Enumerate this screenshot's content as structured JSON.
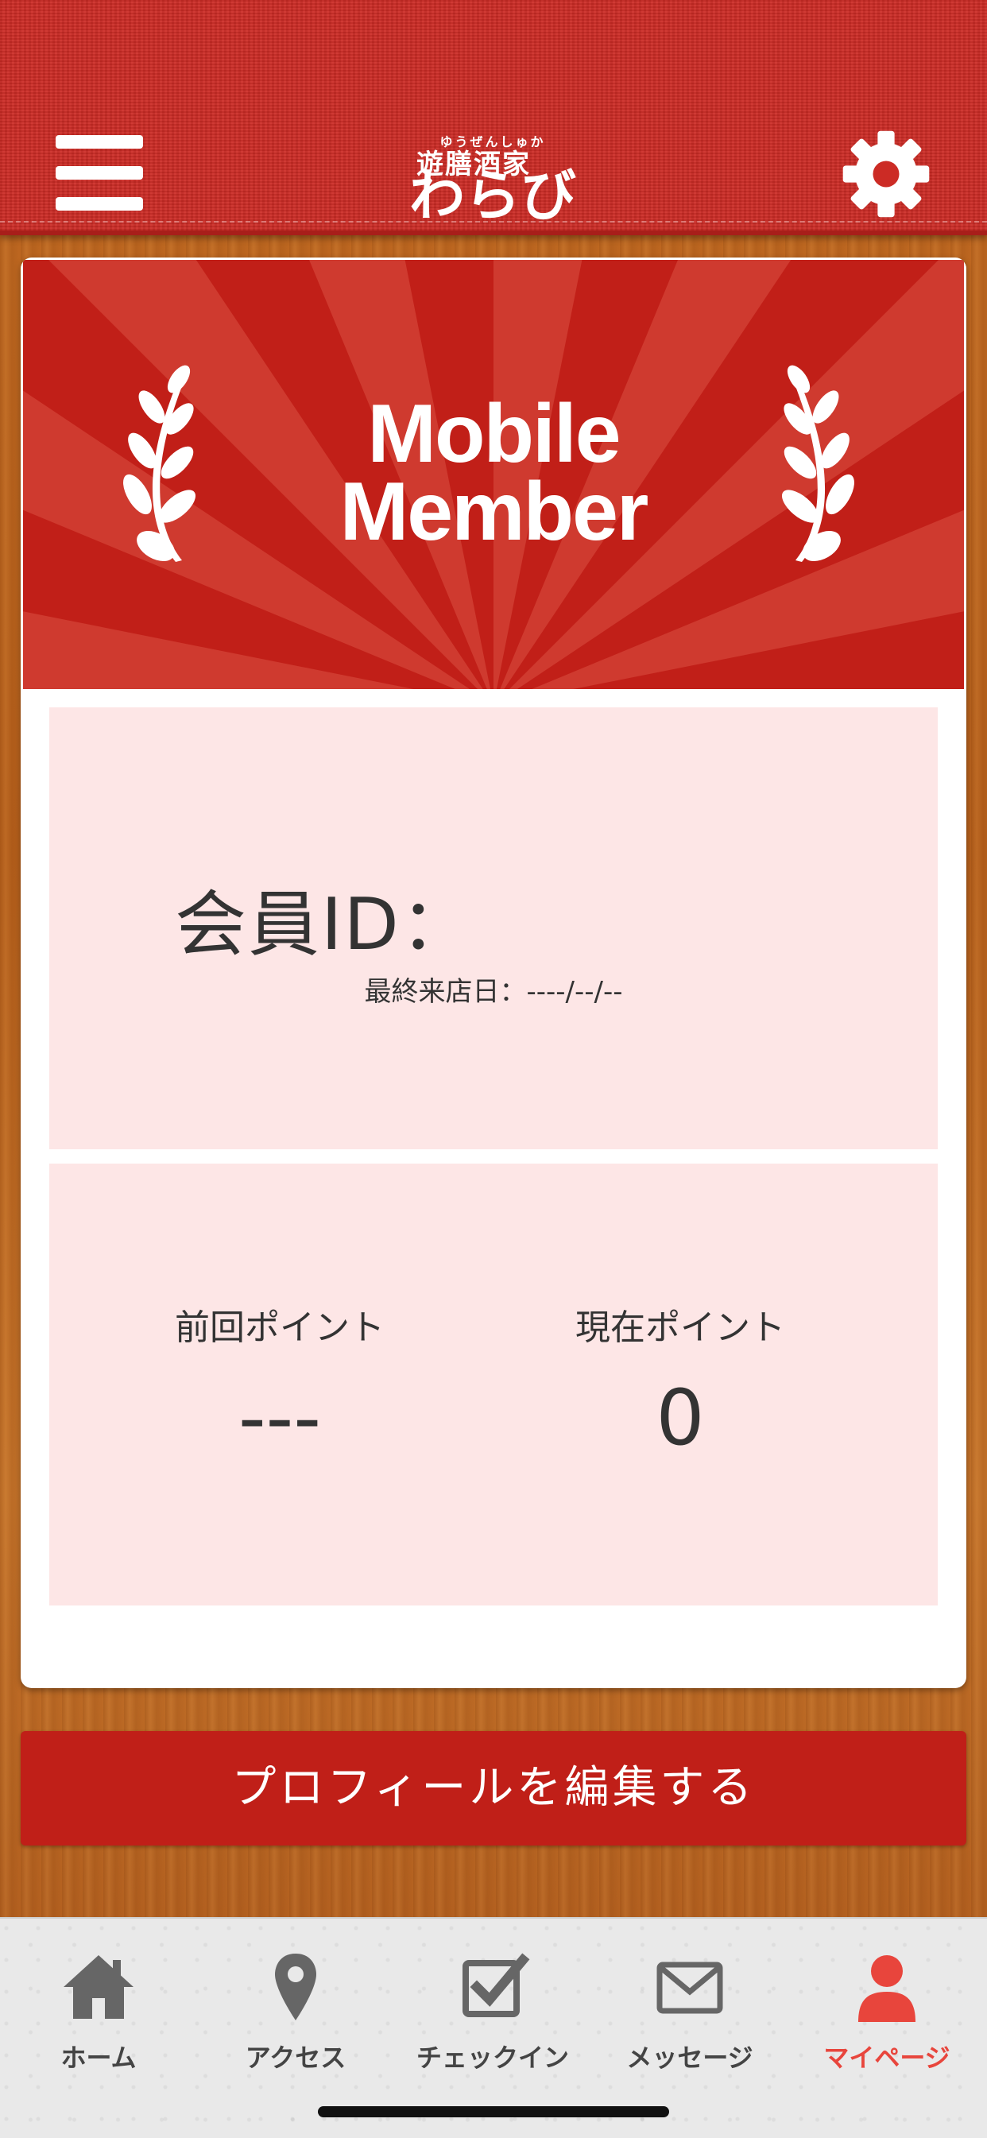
{
  "header": {
    "logo_ruby": "ゆうぜんしゅか",
    "logo_kanji": "遊膳酒家",
    "logo_kana": "わらび",
    "menu_icon": "hamburger-icon",
    "settings_icon": "gear-icon"
  },
  "banner": {
    "title_line1": "Mobile",
    "title_line2": "Member",
    "colors": {
      "red": "#c11f18",
      "ray": "#cf3a2f"
    }
  },
  "member": {
    "id_label": "会員ID：",
    "last_visit": "最終来店日：----/--/--"
  },
  "points": {
    "previous_label": "前回ポイント",
    "previous_value": "---",
    "current_label": "現在ポイント",
    "current_value": "0"
  },
  "edit_button": "プロフィールを編集する",
  "tabs": [
    {
      "label": "ホーム",
      "icon": "home-icon"
    },
    {
      "label": "アクセス",
      "icon": "map-pin-icon"
    },
    {
      "label": "チェックイン",
      "icon": "checkbox-icon"
    },
    {
      "label": "メッセージ",
      "icon": "envelope-icon"
    },
    {
      "label": "マイページ",
      "icon": "user-icon",
      "active": true
    }
  ],
  "colors": {
    "accent": "#c01f18",
    "active_tab": "#e8453c",
    "panel": "#fde6e6"
  }
}
